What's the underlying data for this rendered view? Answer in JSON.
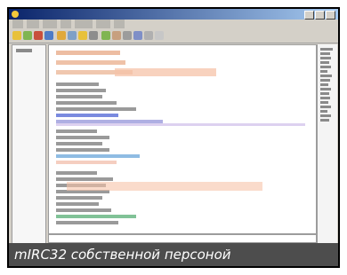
{
  "caption": "mIRC32 собственной персоной",
  "colors": {
    "title_bar": "#0a246a",
    "window_chrome": "#d4d0c8",
    "chat_background": "#ffffff",
    "caption_background": "#4d4d4d",
    "caption_text": "#ffffff",
    "highlight": "#f6c3a8",
    "link": "#4d63d4",
    "join": "#2d9a52"
  }
}
